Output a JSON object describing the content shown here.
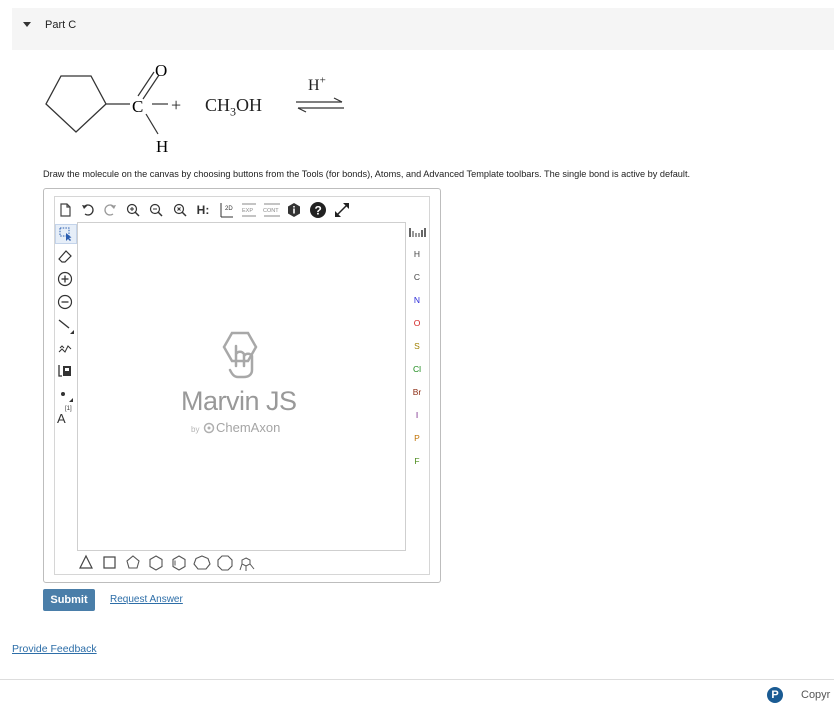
{
  "part": {
    "title": "Part C"
  },
  "reaction": {
    "plus": "+",
    "reagent": "CH3OH",
    "catalyst": "H+",
    "aldehyde_labels": {
      "oxygen": "O",
      "carbon": "C",
      "hydrogen": "H"
    }
  },
  "instructions": "Draw the molecule on the canvas by choosing buttons from the Tools (for bonds), Atoms, and Advanced Template toolbars. The single bond is active by default.",
  "marvin": {
    "top_toolbar": {
      "explicit_h": "H:",
      "two_d": "2D",
      "exp": "EXP",
      "cont": "CONT"
    },
    "left_toolbar": {
      "text_tool": "A",
      "text_tool_sup": "[1]"
    },
    "atoms": [
      "H",
      "C",
      "N",
      "O",
      "S",
      "Cl",
      "Br",
      "I",
      "P",
      "F"
    ],
    "atom_colors": [
      "#444444",
      "#444444",
      "#2a2ad8",
      "#d22020",
      "#a08000",
      "#1a8a1a",
      "#8a2a10",
      "#7a2a8a",
      "#c07000",
      "#4a8a1a"
    ],
    "logo": {
      "name": "Marvin JS",
      "by": "by",
      "company": "ChemAxon"
    }
  },
  "actions": {
    "submit": "Submit",
    "request_answer": "Request Answer"
  },
  "feedback": {
    "label": "Provide Feedback"
  },
  "footer": {
    "pearson_glyph": "P",
    "copyright": "Copyr"
  },
  "colors": {
    "submit_bg": "#4a7ea9",
    "link": "#2d6ea8",
    "pearson": "#1a5b93"
  }
}
